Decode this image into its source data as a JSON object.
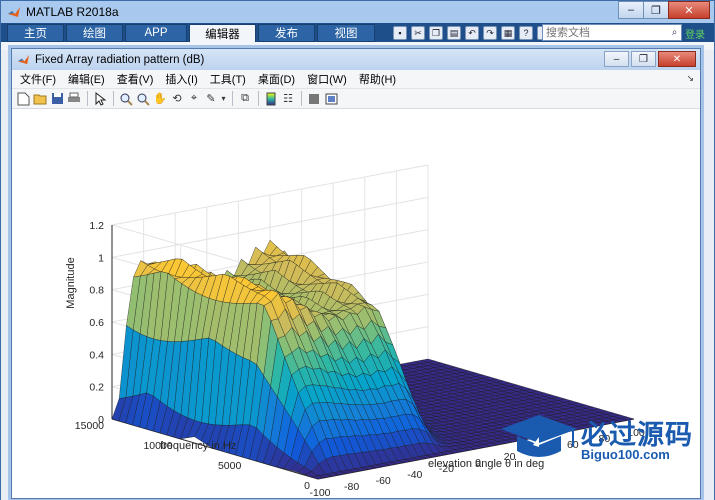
{
  "app": {
    "title": "MATLAB R2018a",
    "window_controls": [
      "–",
      "❐",
      "✕"
    ]
  },
  "ribbon": {
    "tabs": [
      "主页",
      "绘图",
      "APP",
      "编辑器",
      "发布",
      "视图"
    ],
    "active_tab": "编辑器",
    "search_placeholder": "搜索文档",
    "signin": "登录"
  },
  "figure": {
    "title": "Fixed Array radiation pattern (dB)",
    "window_controls": [
      "–",
      "❐",
      "✕"
    ],
    "menu": [
      "文件(F)",
      "编辑(E)",
      "查看(V)",
      "插入(I)",
      "工具(T)",
      "桌面(D)",
      "窗口(W)",
      "帮助(H)"
    ]
  },
  "toolbar": {
    "icons": [
      "new-figure-icon",
      "open-file-icon",
      "save-icon",
      "print-icon",
      "pointer-icon",
      "zoom-in-icon",
      "zoom-out-icon",
      "pan-icon",
      "rotate-3d-icon",
      "data-cursor-icon",
      "brush-icon",
      "link-plot-icon",
      "colorbar-icon",
      "legend-icon",
      "hide-plot-tools-icon",
      "show-plot-tools-icon"
    ]
  },
  "chart_data": {
    "type": "surface",
    "zlabel": "Magnitude",
    "ylabel": "frequency in Hz",
    "xlabel": "elevation angle θ in deg",
    "z_ticks": [
      "0",
      "0.2",
      "0.4",
      "0.6",
      "0.8",
      "1",
      "1.2"
    ],
    "zlim": [
      0,
      1.2
    ],
    "y_ticks": [
      "15000",
      "10000",
      "5000",
      "0"
    ],
    "ylim": [
      0,
      15000
    ],
    "x_ticks": [
      "-100",
      "-80",
      "-60",
      "-40",
      "-20",
      "0",
      "20",
      "40",
      "60",
      "80",
      "100"
    ],
    "xlim": [
      -100,
      100
    ],
    "colormap": "parula",
    "colormap_colors": [
      "#352a87",
      "#0f5cdd",
      "#1481d6",
      "#06a4ca",
      "#2eb7a4",
      "#87bf77",
      "#d1bb59",
      "#fec832",
      "#f9fb0e"
    ]
  },
  "watermark": {
    "text": "必过源码",
    "url": "Biguo100.com"
  }
}
